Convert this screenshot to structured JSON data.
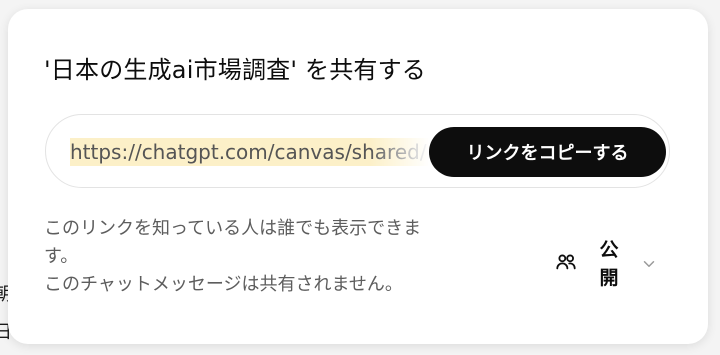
{
  "background": {
    "line1": "朝",
    "line2": "日."
  },
  "dialog": {
    "title": "'日本の生成ai市場調査' を共有する",
    "url": "https://chatgpt.com/canvas/shared/",
    "copy_button_label": "リンクをコピーする",
    "description_line1": "このリンクを知っている人は誰でも表示できま",
    "description_line2": "す。",
    "description_line3": "このチャットメッセージは共有されません。",
    "visibility_label": "公開",
    "visibility_icon": "people-icon",
    "dropdown_icon": "chevron-down-icon"
  },
  "colors": {
    "primary_button": "#0d0d0d",
    "url_highlight": "#fcf0c8",
    "secondary_text": "#5d5d5d"
  }
}
